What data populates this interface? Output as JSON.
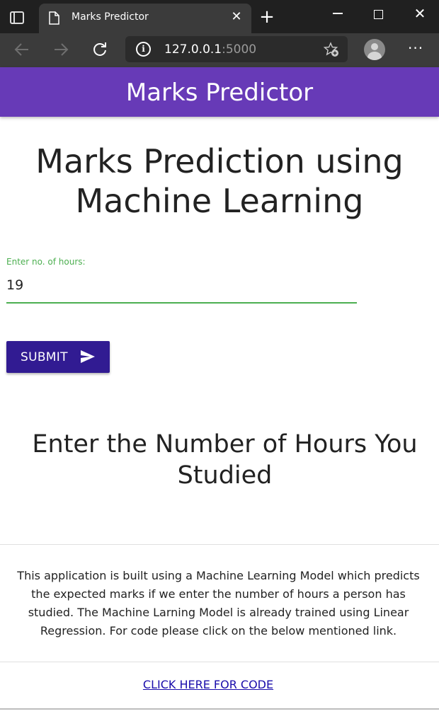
{
  "browser": {
    "tab_title": "Marks Predictor",
    "url_host": "127.0.0.1",
    "url_port": ":5000"
  },
  "header": {
    "title": "Marks Predictor"
  },
  "main": {
    "heading": "Marks Prediction using Machine Learning",
    "hours_field": {
      "label": "Enter no. of hours:",
      "value": "19"
    },
    "submit_label": "SUBMIT",
    "result_heading": "Enter the Number of Hours You Studied"
  },
  "footer": {
    "description": "This application is built using a Machine Learning Model which predicts the expected marks if we enter the number of hours a person has studied. The Machine Larning Model is already trained using Linear Regression. For code please click on the below mentioned link.",
    "code_link": "CLICK HERE FOR CODE"
  },
  "colors": {
    "header_bg": "#673ab7",
    "button_bg": "#311b92",
    "input_accent": "#4caf50",
    "link": "#1a0dab"
  }
}
